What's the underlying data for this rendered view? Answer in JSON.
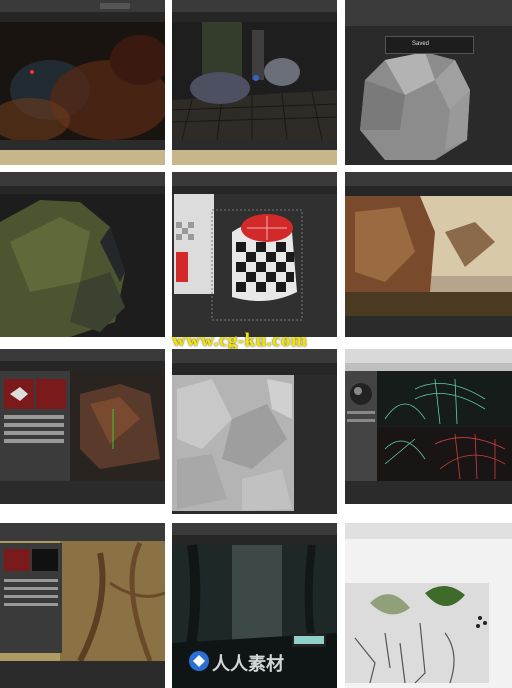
{
  "watermark": {
    "url_text": "www.cg-ku.com",
    "brand_text": "人人素材"
  },
  "tiles": [
    {
      "id": "r1c1",
      "subject": "dark forest cave scene with red/orange foliage",
      "bg": "#1a1411"
    },
    {
      "id": "r1c2",
      "subject": "rock on cobblestone ground in viewport",
      "bg": "#1c1c1c"
    },
    {
      "id": "r1c3",
      "subject": "grey sculpted rock",
      "bg": "#2a2a2a",
      "notice": "Saved"
    },
    {
      "id": "r2c1",
      "subject": "mossy rock on dark background",
      "bg": "#1b1b1b"
    },
    {
      "id": "r2c2",
      "subject": "red checker UV-mapped tree stump",
      "bg": "#2b2b2b"
    },
    {
      "id": "r2c3",
      "subject": "rock cliff in sunset landscape",
      "bg": "#3a2c22"
    },
    {
      "id": "r3c1",
      "subject": "material editor and textured rock",
      "bg": "#1e1e1e"
    },
    {
      "id": "r3c2",
      "subject": "grey sculpted rock surface",
      "bg": "#232323"
    },
    {
      "id": "r3c3",
      "subject": "wireframe roots/foliage viewports",
      "bg": "#1f1f1f"
    },
    {
      "id": "r4c1",
      "subject": "forest with twisted trees and editor panel",
      "bg": "#2a2215"
    },
    {
      "id": "r4c2",
      "subject": "misty dark forest rendering",
      "bg": "#192020"
    },
    {
      "id": "r4c3",
      "subject": "leaf and branch sprite sheet",
      "bg": "#eeeeee"
    }
  ],
  "colors": {
    "watermark_yellow": "#f2e600",
    "ui_dark": "#2b2b2b",
    "ui_bar": "#3a3a3a",
    "checker_red": "#d22a2a",
    "wire_green": "#5fd0a4"
  }
}
